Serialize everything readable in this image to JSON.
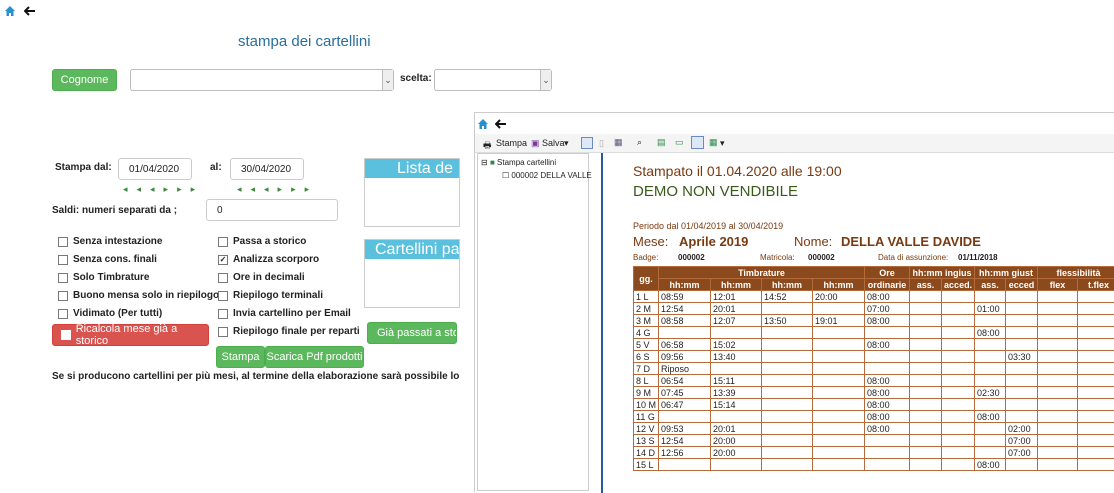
{
  "page": {
    "title": "stampa dei cartellini"
  },
  "top": {
    "cognome_label": "Cognome",
    "scelta_label": "scelta:"
  },
  "dates": {
    "dal_label": "Stampa dal:",
    "dal_value": "01/04/2020",
    "al_label": "al:",
    "al_value": "30/04/2020"
  },
  "saldi": {
    "label": "Saldi: numeri separati da ;",
    "value": "0"
  },
  "checks_left": [
    {
      "label": "Senza intestazione",
      "checked": false
    },
    {
      "label": "Senza cons. finali",
      "checked": false
    },
    {
      "label": "Solo Timbrature",
      "checked": false
    },
    {
      "label": "Buono mensa solo in riepilogo",
      "checked": false
    },
    {
      "label": "Vidimato (Per tutti)",
      "checked": false
    }
  ],
  "checks_right": [
    {
      "label": "Passa a storico",
      "checked": false
    },
    {
      "label": "Analizza scorporo",
      "checked": true
    },
    {
      "label": "Ore in decimali",
      "checked": false
    },
    {
      "label": "Riepilogo terminali",
      "checked": false
    },
    {
      "label": "Invia cartellino per Email",
      "checked": false
    },
    {
      "label": "Riepilogo finale per reparti",
      "checked": false
    }
  ],
  "buttons": {
    "ricalcola": "Ricalcola mese già a storico",
    "gia_passati": "Già passati a storic",
    "stampa": "Stampa",
    "scarica": "Scarica Pdf prodotti"
  },
  "panels": {
    "lista": "Lista de",
    "cartellini": "Cartellini pa"
  },
  "note": "Se si producono cartellini per più mesi, al termine della elaborazione sarà possibile lo s",
  "viewer": {
    "toolbar": {
      "stampa": "Stampa",
      "salva": "Salva"
    },
    "tree": {
      "root": "Stampa cartellini",
      "child": "000002 DELLA VALLE"
    },
    "report": {
      "stampato": "Stampato il 01.04.2020 alle 19:00",
      "demo": "DEMO NON VENDIBILE",
      "periodo": "Periodo dal 01/04/2019 al 30/04/2019",
      "mese_label": "Mese:",
      "mese_value": "Aprile 2019",
      "nome_label": "Nome:",
      "nome_value": "DELLA VALLE DAVIDE",
      "badge_label": "Badge:",
      "badge_value": "000002",
      "matricola_label": "Matricola:",
      "matricola_value": "000002",
      "assunzione_label": "Data di assunzione:",
      "assunzione_value": "01/11/2018",
      "headers": {
        "gg": "gg.",
        "timbrature": "Timbrature",
        "ore": "Ore",
        "ordinarie": "ordinarie",
        "ingius": "hh:mm ingius",
        "giust": "hh:mm giust",
        "flessibilita": "flessibilità",
        "hhmm": "hh:mm",
        "ass": "ass.",
        "acced": "acced.",
        "ecced": "ecced",
        "flex": "flex",
        "tflex": "t.flex"
      },
      "rows": [
        [
          "1 L",
          "08:59",
          "12:01",
          "14:52",
          "20:00",
          "08:00",
          "",
          "",
          "",
          "",
          "",
          ""
        ],
        [
          "2 M",
          "12:54",
          "20:01",
          "",
          "",
          "07:00",
          "",
          "",
          "01:00",
          "",
          "",
          ""
        ],
        [
          "3 M",
          "08:58",
          "12:07",
          "13:50",
          "19:01",
          "08:00",
          "",
          "",
          "",
          "",
          "",
          ""
        ],
        [
          "4 G",
          "",
          "",
          "",
          "",
          "",
          "",
          "",
          "08:00",
          "",
          "",
          ""
        ],
        [
          "5 V",
          "06:58",
          "15:02",
          "",
          "",
          "08:00",
          "",
          "",
          "",
          "",
          "",
          ""
        ],
        [
          "6 S",
          "09:56",
          "13:40",
          "",
          "",
          "",
          "",
          "",
          "",
          "03:30",
          "",
          ""
        ],
        [
          "7 D",
          "Riposo",
          "",
          "",
          "",
          "",
          "",
          "",
          "",
          "",
          "",
          ""
        ],
        [
          "8 L",
          "06:54",
          "15:11",
          "",
          "",
          "08:00",
          "",
          "",
          "",
          "",
          "",
          ""
        ],
        [
          "9 M",
          "07:45",
          "13:39",
          "",
          "",
          "08:00",
          "",
          "",
          "02:30",
          "",
          "",
          ""
        ],
        [
          "10 M",
          "06:47",
          "15:14",
          "",
          "",
          "08:00",
          "",
          "",
          "",
          "",
          "",
          ""
        ],
        [
          "11 G",
          "",
          "",
          "",
          "",
          "08:00",
          "",
          "",
          "08:00",
          "",
          "",
          ""
        ],
        [
          "12 V",
          "09:53",
          "20:01",
          "",
          "",
          "08:00",
          "",
          "",
          "",
          "02:00",
          "",
          ""
        ],
        [
          "13 S",
          "12:54",
          "20:00",
          "",
          "",
          "",
          "",
          "",
          "",
          "07:00",
          "",
          ""
        ],
        [
          "14 D",
          "12:56",
          "20:00",
          "",
          "",
          "",
          "",
          "",
          "",
          "07:00",
          "",
          ""
        ],
        [
          "15 L",
          "",
          "",
          "",
          "",
          "",
          "",
          "",
          "08:00",
          "",
          "",
          ""
        ]
      ]
    }
  }
}
